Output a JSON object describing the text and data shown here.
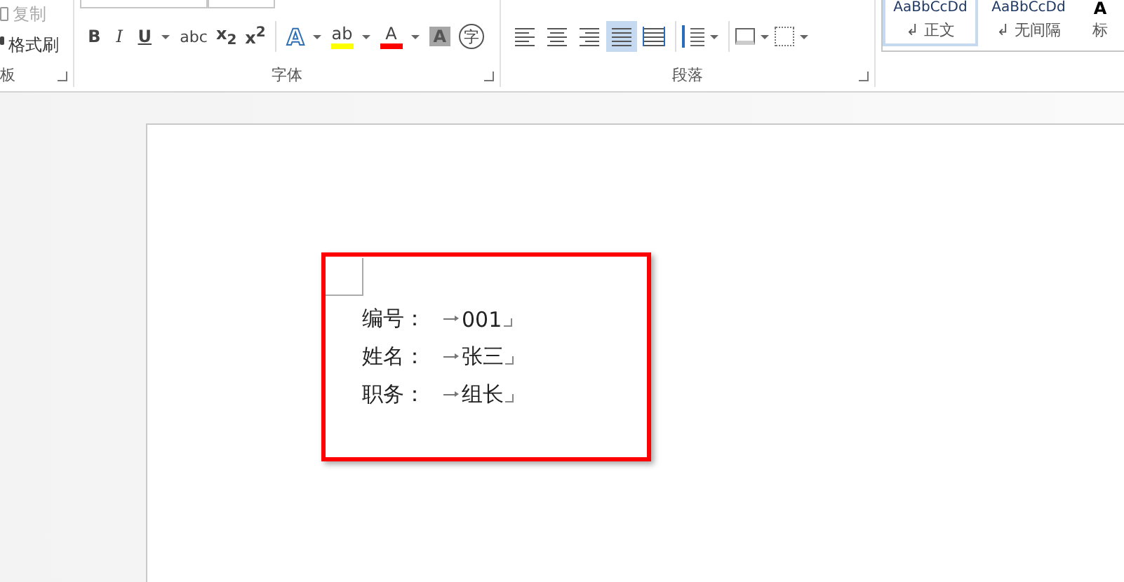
{
  "clipboard": {
    "items": [
      {
        "label": "复制",
        "disabled": true
      },
      {
        "label": "格式刷",
        "disabled": false
      }
    ],
    "label": "板"
  },
  "font": {
    "label": "字体",
    "buttons": [
      {
        "kind": "bold",
        "label": "B"
      },
      {
        "kind": "italic",
        "label": "I"
      },
      {
        "kind": "underline",
        "label": "U",
        "dropdown": true
      },
      {
        "kind": "strike",
        "label": "abc"
      },
      {
        "kind": "plain",
        "label": "x$_{2}$"
      },
      {
        "kind": "plain",
        "label": "x$^{2}$"
      },
      {
        "kind": "sep"
      },
      {
        "kind": "outline",
        "label": "A",
        "dropdown": true
      },
      {
        "kind": "bar",
        "label": "ab",
        "color": "#ffff00",
        "dropdown": true
      },
      {
        "kind": "bar",
        "label": "A",
        "color": "#ff0000",
        "dropdown": true
      },
      {
        "kind": "shade",
        "label": "A"
      },
      {
        "kind": "circle",
        "label": "字"
      }
    ]
  },
  "paragraph": {
    "label": "段落",
    "alignments": [
      {
        "selected": false
      },
      {
        "selected": false
      },
      {
        "selected": false
      },
      {
        "selected": true
      },
      {
        "selected": false
      }
    ]
  },
  "styles": [
    {
      "preview": "AaBbCcDd",
      "name": "↲ 正文",
      "selected": true
    },
    {
      "preview": "AaBbCcDd",
      "name": "↲ 无间隔",
      "selected": false
    },
    {
      "preview": "A",
      "name": "标",
      "selected": false
    }
  ],
  "document": {
    "lines": [
      {
        "label": "编号：",
        "value": "001"
      },
      {
        "label": "姓名：",
        "value": "张三"
      },
      {
        "label": "职务：",
        "value": "组长"
      }
    ]
  }
}
